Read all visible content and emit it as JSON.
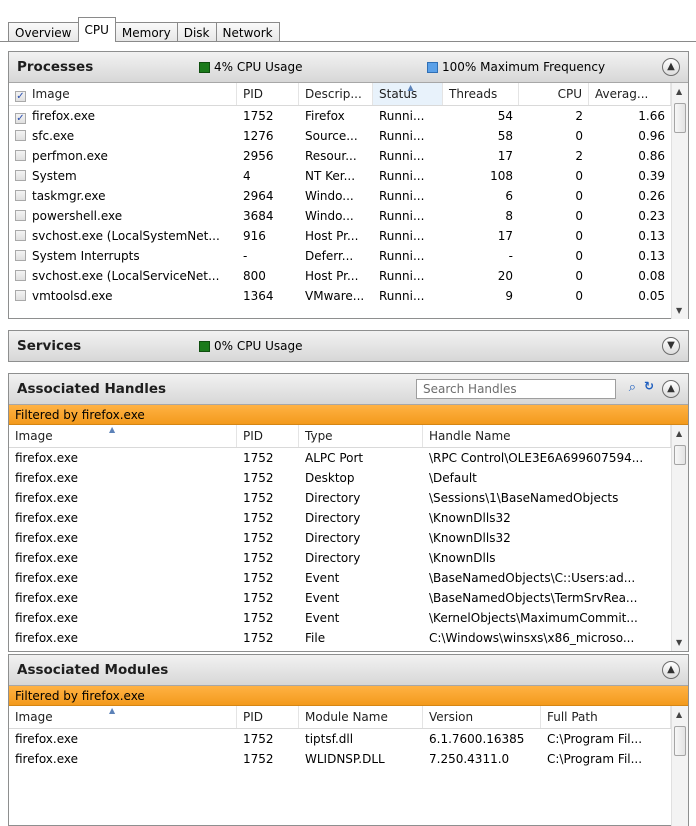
{
  "tabs": [
    "Overview",
    "CPU",
    "Memory",
    "Disk",
    "Network"
  ],
  "active_tab": "CPU",
  "processes": {
    "title": "Processes",
    "cpu_usage": "4% CPU Usage",
    "max_freq": "100% Maximum Frequency",
    "columns": [
      "Image",
      "PID",
      "Descrip...",
      "Status",
      "Threads",
      "CPU",
      "Averag..."
    ],
    "rows": [
      {
        "checked": true,
        "image": "firefox.exe",
        "pid": "1752",
        "desc": "Firefox",
        "status": "Runni...",
        "threads": "54",
        "cpu": "2",
        "avg": "1.66"
      },
      {
        "checked": false,
        "image": "sfc.exe",
        "pid": "1276",
        "desc": "Source...",
        "status": "Runni...",
        "threads": "58",
        "cpu": "0",
        "avg": "0.96"
      },
      {
        "checked": false,
        "image": "perfmon.exe",
        "pid": "2956",
        "desc": "Resour...",
        "status": "Runni...",
        "threads": "17",
        "cpu": "2",
        "avg": "0.86"
      },
      {
        "checked": false,
        "image": "System",
        "pid": "4",
        "desc": "NT Ker...",
        "status": "Runni...",
        "threads": "108",
        "cpu": "0",
        "avg": "0.39"
      },
      {
        "checked": false,
        "image": "taskmgr.exe",
        "pid": "2964",
        "desc": "Windo...",
        "status": "Runni...",
        "threads": "6",
        "cpu": "0",
        "avg": "0.26"
      },
      {
        "checked": false,
        "image": "powershell.exe",
        "pid": "3684",
        "desc": "Windo...",
        "status": "Runni...",
        "threads": "8",
        "cpu": "0",
        "avg": "0.23"
      },
      {
        "checked": false,
        "image": "svchost.exe (LocalSystemNet...",
        "pid": "916",
        "desc": "Host Pr...",
        "status": "Runni...",
        "threads": "17",
        "cpu": "0",
        "avg": "0.13"
      },
      {
        "checked": false,
        "image": "System Interrupts",
        "pid": "-",
        "desc": "Deferr...",
        "status": "Runni...",
        "threads": "-",
        "cpu": "0",
        "avg": "0.13"
      },
      {
        "checked": false,
        "image": "svchost.exe (LocalServiceNet...",
        "pid": "800",
        "desc": "Host Pr...",
        "status": "Runni...",
        "threads": "20",
        "cpu": "0",
        "avg": "0.08"
      },
      {
        "checked": false,
        "image": "vmtoolsd.exe",
        "pid": "1364",
        "desc": "VMware...",
        "status": "Runni...",
        "threads": "9",
        "cpu": "0",
        "avg": "0.05"
      }
    ]
  },
  "services": {
    "title": "Services",
    "cpu_usage": "0% CPU Usage"
  },
  "handles": {
    "title": "Associated Handles",
    "search_placeholder": "Search Handles",
    "filter": "Filtered by firefox.exe",
    "columns": [
      "Image",
      "PID",
      "Type",
      "Handle Name"
    ],
    "rows": [
      {
        "image": "firefox.exe",
        "pid": "1752",
        "type": "ALPC Port",
        "name": "\\RPC Control\\OLE3E6A699607594..."
      },
      {
        "image": "firefox.exe",
        "pid": "1752",
        "type": "Desktop",
        "name": "\\Default"
      },
      {
        "image": "firefox.exe",
        "pid": "1752",
        "type": "Directory",
        "name": "\\Sessions\\1\\BaseNamedObjects"
      },
      {
        "image": "firefox.exe",
        "pid": "1752",
        "type": "Directory",
        "name": "\\KnownDlls32"
      },
      {
        "image": "firefox.exe",
        "pid": "1752",
        "type": "Directory",
        "name": "\\KnownDlls32"
      },
      {
        "image": "firefox.exe",
        "pid": "1752",
        "type": "Directory",
        "name": "\\KnownDlls"
      },
      {
        "image": "firefox.exe",
        "pid": "1752",
        "type": "Event",
        "name": "\\BaseNamedObjects\\C::Users:ad..."
      },
      {
        "image": "firefox.exe",
        "pid": "1752",
        "type": "Event",
        "name": "\\BaseNamedObjects\\TermSrvRea..."
      },
      {
        "image": "firefox.exe",
        "pid": "1752",
        "type": "Event",
        "name": "\\KernelObjects\\MaximumCommit..."
      },
      {
        "image": "firefox.exe",
        "pid": "1752",
        "type": "File",
        "name": "C:\\Windows\\winsxs\\x86_microso..."
      }
    ]
  },
  "modules": {
    "title": "Associated Modules",
    "filter": "Filtered by firefox.exe",
    "columns": [
      "Image",
      "PID",
      "Module Name",
      "Version",
      "Full Path"
    ],
    "rows": [
      {
        "image": "firefox.exe",
        "pid": "1752",
        "module": "tiptsf.dll",
        "version": "6.1.7600.16385",
        "path": "C:\\Program Fil..."
      },
      {
        "image": "firefox.exe",
        "pid": "1752",
        "module": "WLIDNSP.DLL",
        "version": "7.250.4311.0",
        "path": "C:\\Program Fil..."
      }
    ]
  },
  "colors": {
    "filter_bar": "#f7a52e",
    "cpu_square": "#1a7a1a",
    "freq_square": "#5aa0e8"
  }
}
